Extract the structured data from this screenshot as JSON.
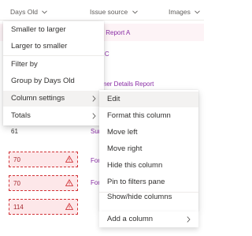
{
  "columns": {
    "days_old": "Days Old",
    "issue_source": "Issue source",
    "images": "Images"
  },
  "issue_links": [
    "ail Report A",
    "m C",
    "stomer Details Report",
    "Sum",
    "For",
    "For"
  ],
  "rows": {
    "plain_value": "61",
    "error_values": [
      "70",
      "70",
      "114"
    ]
  },
  "context_menu": {
    "items": [
      "Smaller to larger",
      "Larger to smaller",
      "Filter by",
      "Group by Days Old",
      "Column settings",
      "Totals"
    ]
  },
  "submenu": {
    "items": [
      "Edit",
      "Format this column",
      "Move left",
      "Move right",
      "Hide this column",
      "Pin to filters pane",
      "Show/hide columns",
      "Add a column"
    ]
  },
  "colors": {
    "link": "#8a2da5",
    "error_border": "#d13438",
    "error_fill": "#fde7e9",
    "row_selected": "#fdf3f6",
    "hover": "#f3f2f1"
  },
  "icons": [
    "chevron-down-icon",
    "chevron-right-icon",
    "warning-icon"
  ]
}
